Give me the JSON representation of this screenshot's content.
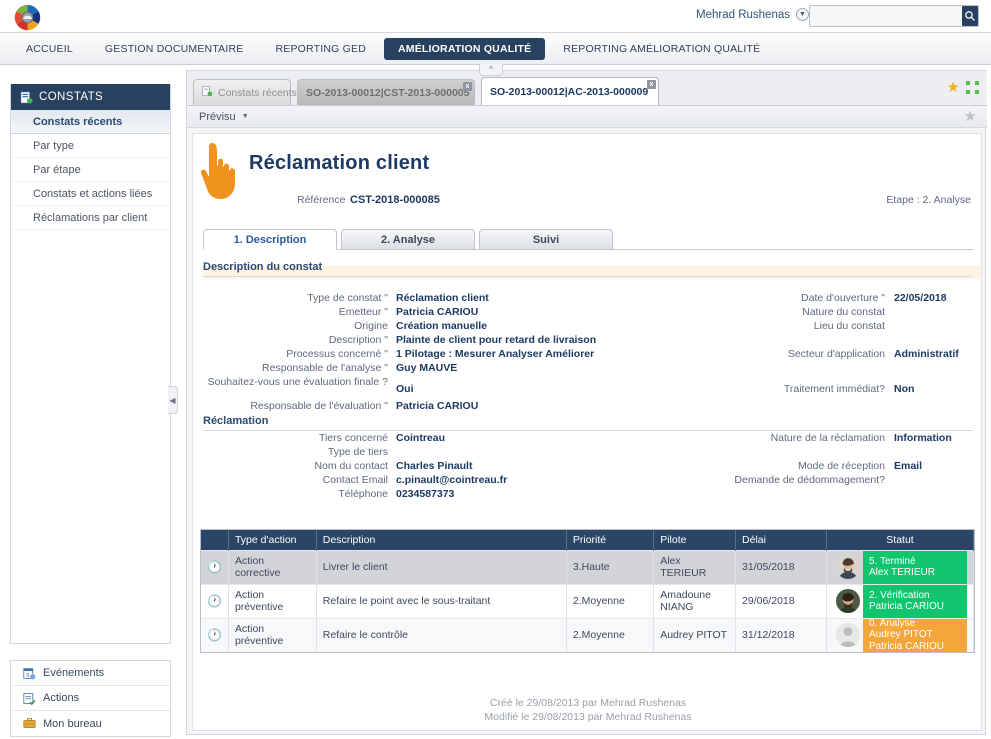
{
  "topbar": {
    "logo_icon": "colorwheel-logo-icon",
    "username": "Mehrad Rushenas",
    "user_caret_icon": "chevron-down-icon",
    "search_value": "",
    "search_placeholder": "",
    "search_icon": "search-icon"
  },
  "nav": {
    "items": [
      {
        "label": "ACCUEIL",
        "active": false
      },
      {
        "label": "GESTION DOCUMENTAIRE",
        "active": false
      },
      {
        "label": "REPORTING GED",
        "active": false
      },
      {
        "label": "AMÉLIORATION QUALITÉ",
        "active": true
      },
      {
        "label": "REPORTING AMÉLIORATION QUALITÉ",
        "active": false
      }
    ]
  },
  "sidebar": {
    "header": "CONSTATS",
    "header_icon": "constats-icon",
    "items": [
      {
        "label": "Constats récents",
        "selected": true
      },
      {
        "label": "Par type",
        "selected": false
      },
      {
        "label": "Par étape",
        "selected": false
      },
      {
        "label": "Constats et actions liées",
        "selected": false
      },
      {
        "label": "Réclamations par client",
        "selected": false
      }
    ],
    "bottom_items": [
      {
        "label": "Evénements",
        "icon": "calendar-icon"
      },
      {
        "label": "Actions",
        "icon": "actions-icon"
      },
      {
        "label": "Mon bureau",
        "icon": "briefcase-icon"
      }
    ],
    "collapse_icon": "chevron-left-icon"
  },
  "doctabs": {
    "collapse_up_icon": "chevron-up-icon",
    "tabs": [
      {
        "label": "Constats récents",
        "style": "inactive-grey",
        "icon": "document-icon",
        "closable": false
      },
      {
        "label": "SO-2013-00012|CST-2013-000005",
        "style": "inactive-mid",
        "closable": true,
        "close_label": "x"
      },
      {
        "label": "SO-2013-00012|AC-2013-000009",
        "style": "active",
        "closable": true,
        "close_label": "x"
      }
    ],
    "favorite_icon": "star-filled-icon",
    "expand_icon": "expand-icon"
  },
  "previsu": {
    "label": "Prévisu",
    "caret_icon": "chevron-down-icon",
    "star_icon": "star-outline-icon"
  },
  "document": {
    "title": "Réclamation client",
    "cursor_icon": "hand-pointer-icon",
    "reference_label": "Référence",
    "reference_value": "CST-2018-000085",
    "etape": "Etape : 2. Analyse",
    "inner_tabs": [
      {
        "label": "1. Description",
        "active": true
      },
      {
        "label": "2. Analyse",
        "active": false
      },
      {
        "label": "Suivi",
        "active": false
      }
    ],
    "section_constat": "Description du constat",
    "section_reclamation": "Réclamation",
    "fields_constat_left": [
      {
        "label": "Type de constat \"",
        "value": "Réclamation client"
      },
      {
        "label": "Emetteur \"",
        "value": "Patricia CARIOU"
      },
      {
        "label": "Origine",
        "value": "Création manuelle"
      },
      {
        "label": "Description \"",
        "value": "Plainte de client pour retard de livraison"
      },
      {
        "label": "Processus concerné \"",
        "value": "1 Pilotage : Mesurer Analyser Améliorer"
      },
      {
        "label": "Responsable de l'analyse \"",
        "value": "Guy MAUVE"
      },
      {
        "label": "Souhaitez-vous une évaluation finale ?",
        "value": "Oui"
      },
      {
        "label": "Responsable de l'évaluation \"",
        "value": "Patricia CARIOU"
      }
    ],
    "fields_constat_right": [
      {
        "label": "Date d'ouverture \"",
        "value": "22/05/2018"
      },
      {
        "label": "Nature du constat",
        "value": ""
      },
      {
        "label": "Lieu du constat",
        "value": ""
      },
      {
        "label": "Secteur d'application",
        "value": "Administratif"
      },
      {
        "label": "Traitement immédiat?",
        "value": "Non"
      }
    ],
    "fields_reclam_left": [
      {
        "label": "Tiers concerné",
        "value": "Cointreau"
      },
      {
        "label": "Type de tiers",
        "value": ""
      },
      {
        "label": "Nom du contact",
        "value": "Charles Pinault"
      },
      {
        "label": "Contact Email",
        "value": "c.pinault@cointreau.fr"
      },
      {
        "label": "Téléphone",
        "value": "0234587373"
      }
    ],
    "fields_reclam_right": [
      {
        "label": "Nature de la réclamation",
        "value": "Information"
      },
      {
        "label": "Mode de réception",
        "value": "Email"
      },
      {
        "label": "Demande de dédommagement?",
        "value": ""
      }
    ],
    "footer_created": "Créé le 29/08/2013 par Mehrad Rushenas",
    "footer_modified": "Modifié le 29/08/2013 par Mehrad Rushenas"
  },
  "actions_table": {
    "columns": [
      "",
      "Type d'action",
      "Description",
      "Priorité",
      "Pilote",
      "Délai",
      "Statut"
    ],
    "rows": [
      {
        "row_icon": "history-clock-icon",
        "type": "Action corrective",
        "description": "Livrer le client",
        "priorite": "3.Haute",
        "pilote": "Alex TERIEUR",
        "delai": "31/05/2018",
        "status_lines": [
          "5. Terminé",
          "Alex TERIEUR"
        ],
        "status_color": "#10c56d",
        "avatar": "photo-avatar-male"
      },
      {
        "row_icon": "history-clock-icon",
        "type": "Action préventive",
        "description": "Refaire le point avec le sous-traitant",
        "priorite": "2.Moyenne",
        "pilote": "Amadoune NIANG",
        "delai": "29/06/2018",
        "status_lines": [
          "2. Vérification",
          "Patricia CARIOU"
        ],
        "status_color": "#10c56d",
        "avatar": "photo-avatar-male2"
      },
      {
        "row_icon": "history-clock-icon",
        "type": "Action préventive",
        "description": "Refaire le contrôle",
        "priorite": "2.Moyenne",
        "pilote": "Audrey PITOT",
        "delai": "31/12/2018",
        "status_lines": [
          "0. Analyse",
          "Audrey PITOT",
          "Patricia CARIOU"
        ],
        "status_color": "#f5a63a",
        "avatar": "placeholder-avatar"
      }
    ]
  },
  "colors": {
    "navy": "#28415f",
    "accent_blue": "#2c5aa0",
    "green_status": "#10c56d",
    "orange_status": "#f5a63a",
    "highlight_row": "#fdf4e3",
    "orange_cursor": "#f0921e"
  }
}
